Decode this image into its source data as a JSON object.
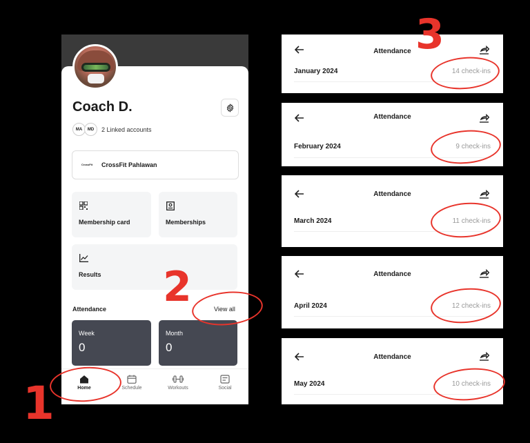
{
  "profile": {
    "name": "Coach D.",
    "linked_chips": [
      "MA",
      "MD"
    ],
    "linked_text": "2 Linked accounts",
    "gym_logo_text": "CrossFit",
    "gym_name": "CrossFit Pahlawan"
  },
  "tiles": {
    "membership_card": "Membership card",
    "memberships": "Memberships",
    "results": "Results"
  },
  "attendance": {
    "title": "Attendance",
    "view_all": "View all",
    "week_label": "Week",
    "week_value": "0",
    "month_label": "Month",
    "month_value": "0"
  },
  "nav": {
    "home": "Home",
    "schedule": "Schedule",
    "workouts": "Workouts",
    "social": "Social"
  },
  "panels": [
    {
      "title": "Attendance",
      "month": "January 2024",
      "count": "14 check-ins"
    },
    {
      "title": "Attendance",
      "month": "February 2024",
      "count": "9 check-ins"
    },
    {
      "title": "Attendance",
      "month": "March 2024",
      "count": "11 check-ins"
    },
    {
      "title": "Attendance",
      "month": "April 2024",
      "count": "12 check-ins"
    },
    {
      "title": "Attendance",
      "month": "May 2024",
      "count": "10 check-ins"
    }
  ],
  "annotations": {
    "step1": "1",
    "step2": "2",
    "step3": "3"
  },
  "colors": {
    "annotation": "#e8342b",
    "card_dark": "#454852",
    "header_dark": "#3a3a3a"
  }
}
